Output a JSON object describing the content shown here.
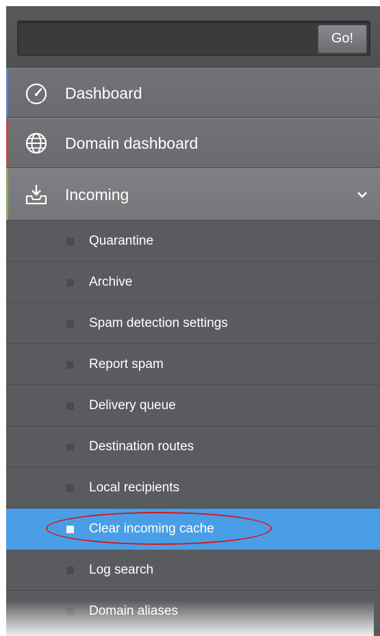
{
  "search": {
    "value": "",
    "placeholder": "",
    "button_label": "Go!"
  },
  "nav": [
    {
      "label": "Dashboard",
      "icon": "dashboard-gauge-icon",
      "accent": "#5b7fd0"
    },
    {
      "label": "Domain dashboard",
      "icon": "globe-icon",
      "accent": "#c84a4a"
    },
    {
      "label": "Incoming",
      "icon": "incoming-tray-icon",
      "accent": "#8faa5a",
      "expanded": true
    }
  ],
  "incoming_items": [
    {
      "label": "Quarantine"
    },
    {
      "label": "Archive"
    },
    {
      "label": "Spam detection settings"
    },
    {
      "label": "Report spam"
    },
    {
      "label": "Delivery queue"
    },
    {
      "label": "Destination routes"
    },
    {
      "label": "Local recipients"
    },
    {
      "label": "Clear incoming cache",
      "active": true
    },
    {
      "label": "Log search"
    },
    {
      "label": "Domain aliases"
    }
  ],
  "colors": {
    "active": "#4a9ee6",
    "panel": "#5a5b5e",
    "highlight_ring": "#e01010"
  }
}
